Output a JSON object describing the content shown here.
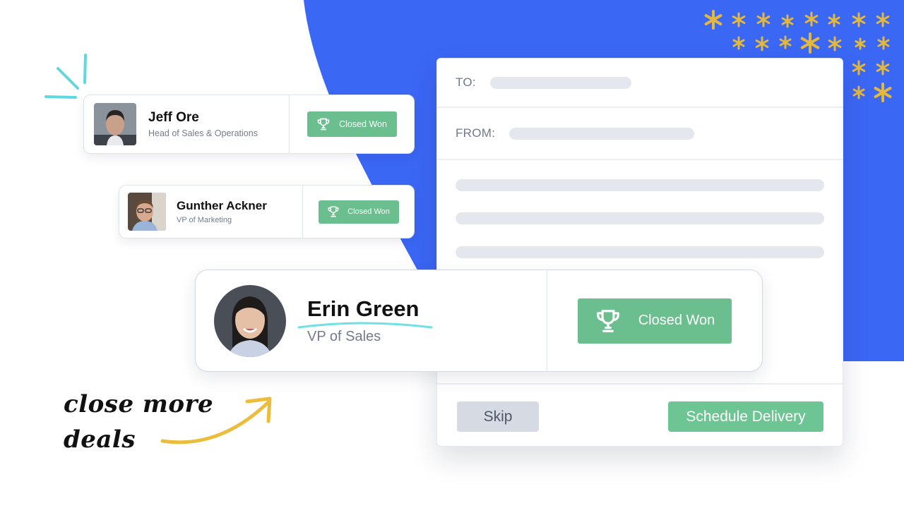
{
  "colors": {
    "background": "#ffffff",
    "blue_blob": "#3b67f5",
    "star": "#e3b83c",
    "sparkle": "#5fd9e0",
    "won_green": "#6bbf8e",
    "schedule_green": "#6cc592",
    "skip_gray": "#d6dae3",
    "arrow_yellow": "#ecbd3a",
    "underline_cyan": "#6fe0e4"
  },
  "contacts": [
    {
      "name": "Jeff Ore",
      "title": "Head of Sales & Operations",
      "status_label": "Closed Won",
      "avatar_shape": "square"
    },
    {
      "name": "Gunther Ackner",
      "title": "VP of Marketing",
      "status_label": "Closed Won",
      "avatar_shape": "square"
    },
    {
      "name": "Erin Green",
      "title": "VP of Sales",
      "status_label": "Closed Won",
      "avatar_shape": "circle"
    }
  ],
  "email": {
    "to_label": "TO:",
    "from_label": "FROM:",
    "skip_label": "Skip",
    "schedule_label": "Schedule Delivery"
  },
  "tagline": {
    "line1": "close more",
    "line2": "deals"
  },
  "icons": {
    "status": "trophy-icon",
    "decoration_stars": "asterisk-icon",
    "decoration_sparkle": "sparkle-icon",
    "arrow": "curved-arrow-icon"
  }
}
